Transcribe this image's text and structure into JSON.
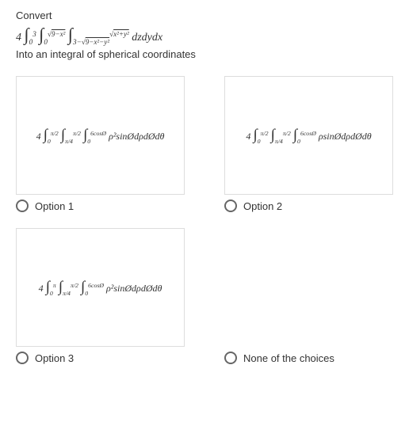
{
  "header": {
    "convert": "Convert",
    "main_integral": "4 ∫₀³ ∫₀^√(9−x²) ∫_(3−√(9−x²−y²))^√(x²+y²) dz dy dx",
    "subtitle": "Into an integral of spherical coordinates"
  },
  "options": {
    "opt1": {
      "formula": "4 ∫₀^(π/2) ∫_(π/4)^(π/2) ∫₀^(6cosØ) ρ² sinØ dρ dØ dθ",
      "label": "Option 1"
    },
    "opt2": {
      "formula": "4 ∫₀^(π/2) ∫_(π/4)^(π/2) ∫₀^(6cosØ) ρ sinØ dρ dØ dθ",
      "label": "Option 2"
    },
    "opt3": {
      "formula": "4 ∫₀^π ∫_(π/4)^(π/2) ∫₀^(6cosØ) ρ² sinØ dρ dØ dθ",
      "label": "Option 3"
    },
    "opt4": {
      "label": "None of the choices"
    }
  }
}
